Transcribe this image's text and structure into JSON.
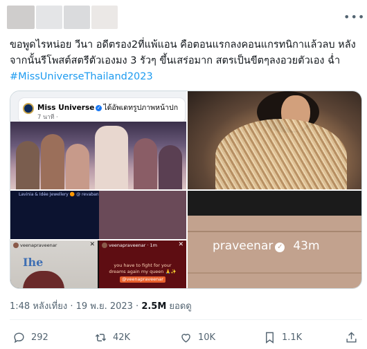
{
  "tweet": {
    "text_line1": "ขอพูดไรหน่อย วีนา อดีตรอง2ที่แพ้แอน คือตอนแรกลงคอนแกรทนิกาแล้วลบ หลัง",
    "text_line2": "จากนั้นรีโพสต์สตรีตัวเองมง 3 รัวๆ ขึ้นเสร่อมาก สตรเป็นขีตๆลงอวยตัวเอง ฉ่ำ",
    "hashtag": "#MissUniverseThailand2023",
    "more_icon": "more-horizontal-icon"
  },
  "media": {
    "fb_post": {
      "page_name": "Miss Universe",
      "action_text": "ได้อัพเดทรูปภาพหน้าปก",
      "time_text": "7 นาที ·"
    },
    "stage_label": "Lavinia & Idée Jewellery 🟠 @ revabands · 4h",
    "story_a": {
      "user": "veenapraveenar",
      "big_text": "Ihe"
    },
    "story_b": {
      "user": "veenapraveenar · 1m",
      "message_line1": "you have to fight for your",
      "message_line2": "dreams again my queen 🙏✨",
      "tag": "@veenapraveenar"
    },
    "ig_overlay": {
      "username": "praveenar",
      "time": "43m"
    }
  },
  "meta": {
    "timestamp": "1:48 หลังเที่ยง · 19 พ.ย. 2023 · ",
    "views": "2.5M",
    "views_label": " ยอดดู"
  },
  "actions": {
    "reply_count": "292",
    "retweet_count": "42K",
    "like_count": "10K",
    "bookmark_count": "1.1K"
  },
  "colors": {
    "link": "#1d9bf0",
    "text": "#0f1419",
    "muted": "#536471"
  }
}
